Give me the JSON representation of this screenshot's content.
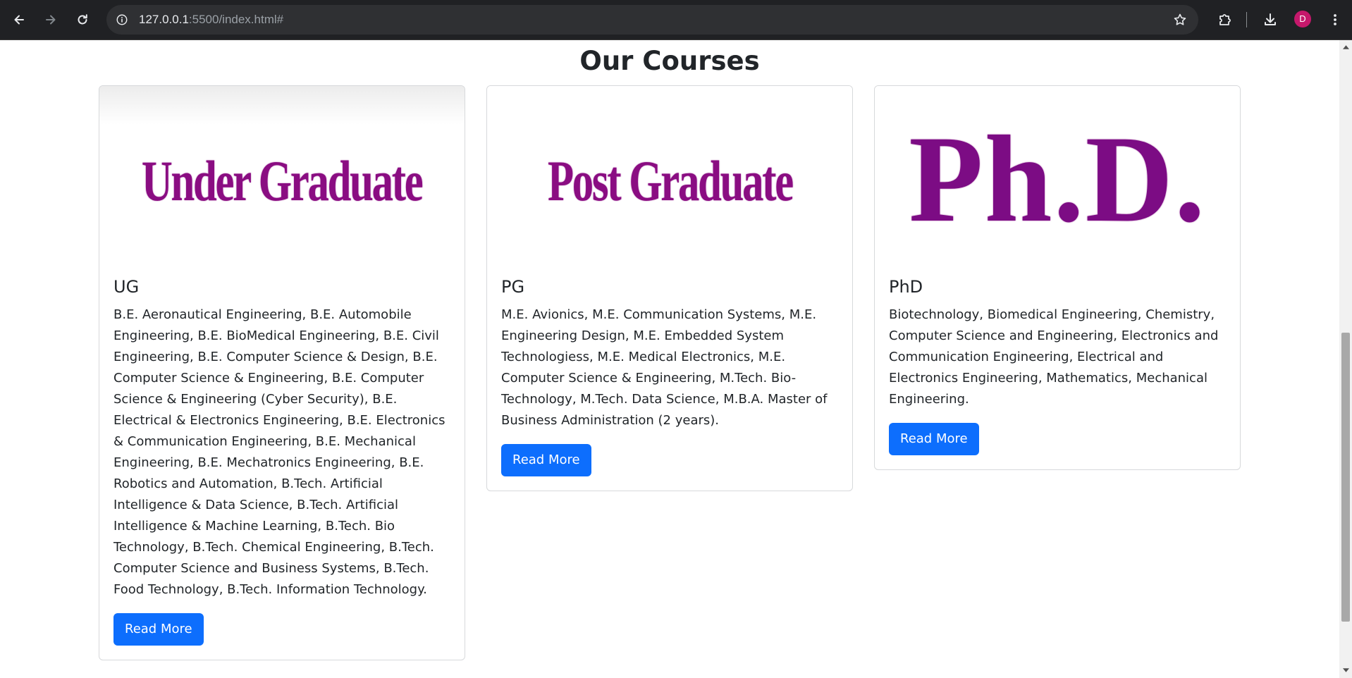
{
  "browser": {
    "url_host": "127.0.0.1",
    "url_rest": ":5500/index.html#",
    "avatar_letter": "D",
    "avatar_color": "#c5186b"
  },
  "page": {
    "title": "Our Courses"
  },
  "courses": [
    {
      "image_text": "Under Graduate",
      "title": "UG",
      "description": "B.E. Aeronautical Engineering, B.E. Automobile Engineering, B.E. BioMedical Engineering, B.E. Civil Engineering, B.E. Computer Science & Design, B.E. Computer Science & Engineering, B.E. Computer Science & Engineering (Cyber Security), B.E. Electrical & Electronics Engineering, B.E. Electronics & Communication Engineering, B.E. Mechanical Engineering, B.E. Mechatronics Engineering, B.E. Robotics and Automation, B.Tech. Artificial Intelligence & Data Science, B.Tech. Artificial Intelligence & Machine Learning, B.Tech. Bio Technology, B.Tech. Chemical Engineering, B.Tech. Computer Science and Business Systems, B.Tech. Food Technology, B.Tech. Information Technology.",
      "button_label": "Read More"
    },
    {
      "image_text": "Post Graduate",
      "title": "PG",
      "description": "M.E. Avionics, M.E. Communication Systems, M.E. Engineering Design, M.E. Embedded System Technologiess, M.E. Medical Electronics, M.E. Computer Science & Engineering, M.Tech. Bio-Technology, M.Tech. Data Science, M.B.A. Master of Business Administration (2 years).",
      "button_label": "Read More"
    },
    {
      "image_text": "Ph.D.",
      "title": "PhD",
      "description": "Biotechnology, Biomedical Engineering, Chemistry, Computer Science and Engineering, Electronics and Communication Engineering, Electrical and Electronics Engineering, Mathematics, Mechanical Engineering.",
      "button_label": "Read More"
    }
  ],
  "colors": {
    "primary_button": "#0d6efd",
    "image_text": "#8a0d82",
    "chrome_bg": "#202124"
  },
  "icons": {
    "back": "arrow-left-icon",
    "forward": "arrow-right-icon",
    "reload": "reload-icon",
    "site_info": "site-info-icon",
    "bookmark": "star-icon",
    "extensions": "puzzle-icon",
    "downloads": "download-icon",
    "menu": "kebab-menu-icon"
  }
}
